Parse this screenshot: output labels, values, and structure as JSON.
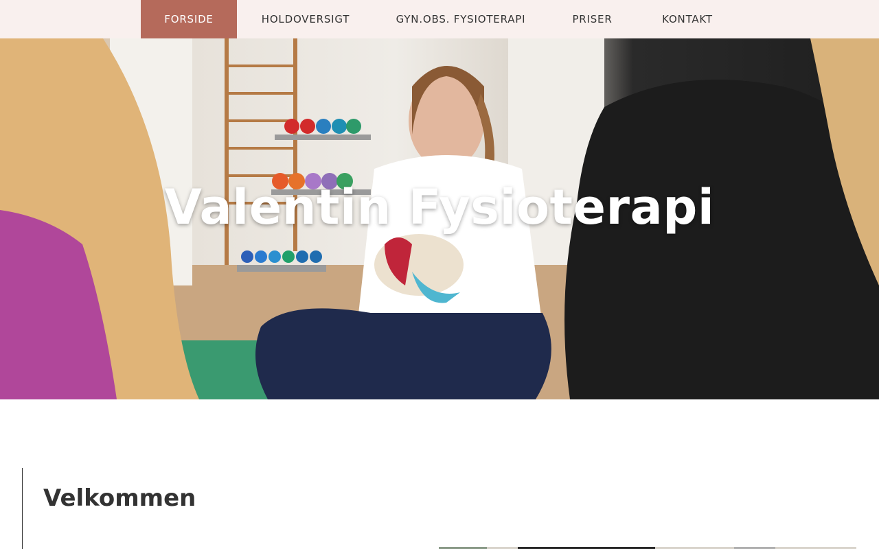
{
  "nav": {
    "items": [
      {
        "label": "FORSIDE",
        "active": true
      },
      {
        "label": "HOLDOVERSIGT",
        "active": false
      },
      {
        "label": "GYN.OBS. FYSIOTERAPI",
        "active": false
      },
      {
        "label": "PRISER",
        "active": false
      },
      {
        "label": "KONTAKT",
        "active": false
      }
    ]
  },
  "hero": {
    "title": "Valentin Fysioterapi",
    "photo_icon": "hero-photo-icon"
  },
  "welcome": {
    "heading": "Velkommen"
  },
  "colors": {
    "nav_bg": "#f9f0ee",
    "nav_active": "#b56a5b",
    "text": "#333333"
  }
}
